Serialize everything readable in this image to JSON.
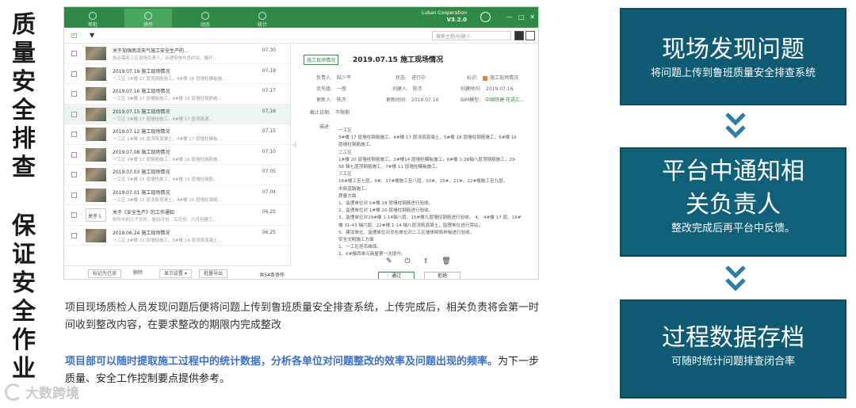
{
  "vertical_title": {
    "part1": [
      "质",
      "量",
      "安",
      "全",
      "排",
      "查"
    ],
    "part2": [
      "保",
      "证",
      "安",
      "全",
      "作",
      "业"
    ]
  },
  "app": {
    "nav": [
      "审批",
      "协作",
      "动态",
      "统计"
    ],
    "brand": "Luban Cooperation",
    "version": "V3.2.0",
    "window_buttons": [
      "—",
      "□",
      "✕"
    ],
    "search_placeholder": "搜索主题/创建人",
    "list": [
      {
        "title": "关于加强南流天气施工安全生产的...",
        "sub": "各必需各工区现场负责人，合理安排作息时间，确开...",
        "date": "07.30",
        "doc": false
      },
      {
        "title": "2019.07.19 施工现场情况",
        "sub": "一工区 3#楼 17 层顶钢筋施工，4#楼 18 层墙柱模板施...",
        "date": "07.19",
        "doc": false
      },
      {
        "title": "2019.07.16 施工现场情况",
        "sub": "一工区 3#楼 17 层楼板施工，4#楼 18 层墙柱钢筋施...",
        "date": "07.17",
        "doc": false
      },
      {
        "title": "2019.07.15 施工现场情况",
        "sub": "一工区 3#楼 17 层墙柱施工，4#楼 17 层浇筑混...",
        "date": "07.16",
        "doc": false
      },
      {
        "title": "2019.07.12 施工现场情况",
        "sub": "一工区 1#楼 16 层浇筑混凝土，4#楼 17 层墙柱模板...",
        "date": "07.15",
        "doc": false
      },
      {
        "title": "2019.07.08 施工现场情况",
        "sub": "一工区 3#楼 17 层钢筋施工，4#楼 16 层墙柱钢筋施...",
        "date": "07.10",
        "doc": false
      },
      {
        "title": "2019.07.03 施工现场情况",
        "sub": "一工区 3#楼 15 层墙柱施工，4#楼 16 层墙柱钢筋...",
        "date": "07.05",
        "doc": false
      },
      {
        "title": "2019.07.01 施工现场情况",
        "sub": "一工区 3#楼 15 层浇筑混凝土，4#楼 15 层墙柱钢筋...",
        "date": "07.04",
        "doc": false
      },
      {
        "title": "关于《安全生产》的工作通知",
        "sub": "附件中的几个文件，是四月份、五月份、六月份建工...",
        "date": "06.25",
        "doc": true,
        "doc_label": "关于ｌ"
      },
      {
        "title": "2019.06.24 施工现场情况",
        "sub": "一工区 3#楼 15 层墙柱施工，5#楼 14 层浇筑混凝土...",
        "date": "06.25",
        "doc": false
      }
    ],
    "list_footer": {
      "mark_read": "标记为已读",
      "delete": "删除",
      "display": "显示设置 ▾",
      "export": "批量导出",
      "count": "共54条协作"
    },
    "detail": {
      "tag": "施工现场情况",
      "title": "2019.07.15 施工现场情况",
      "fields": [
        {
          "k": "负责人:",
          "v": "陆少平"
        },
        {
          "k": "状态:",
          "v": "进行中"
        },
        {
          "k": "标识:",
          "v": "施工现场情况"
        },
        {
          "k": "优先级:",
          "v": "一般"
        },
        {
          "k": "创建人:",
          "v": "陈杰"
        },
        {
          "k": "创建时间:",
          "v": "2019.07.16"
        },
        {
          "k": "更新人:",
          "v": "陈杰"
        },
        {
          "k": "更新时间:",
          "v": "2019.07.16"
        },
        {
          "k": "BIM模型:",
          "v": "中国铁建·花语汇..."
        },
        {
          "k": "截止日期:",
          "v": "不限期"
        }
      ],
      "desc_label": "描述:",
      "desc_lines": [
        "一工区",
        "3#楼 17 层墙柱钢筋施工，4#楼 17 层浇筑混凝土，5#楼 18 层墙柱钢筋施工，6#楼 16",
        "层墙柱钢筋施工。",
        "二工区",
        "1#楼 20 层墙柱钢筋施工，2#楼14 层墙柱模板施工，6#楼 1-28轴八层顶钢筋施工，29-",
        "58 轴七层顶钢筋施工，7#楼 11 层墙柱模板施工。",
        "三工区",
        "16#楼工至七层，9#、17#楼施工至八层，10#、15#、21#、22#楼施工至九层。",
        "市政道路施工。",
        "质量方面:",
        "1、监理单位对 5#楼 18 层墙柱钢筋进行验收。",
        "2、监理单位对 1#楼 20 层墙柱钢筋进行验收。",
        "3、监理单位对29#楼 1-14轴八层、15#楼九层墙柱钢筋进行验收。 4、 4#楼 17 层、16#",
        "楼 31-43 轴六层、22#楼 1-14 轴八层浇筑混凝土，监理单位进行旁站。",
        "5、建设单位、监理单位对总包单位对二工区墙体砌筑样板进行验收。",
        "安全文明施工方面",
        "1、一工区塔吊维保。",
        "2、6#楼西单元商屋第一次提升。"
      ],
      "approve": "通过",
      "reject": "拒绝"
    }
  },
  "body": {
    "para1": "项目现场质检人员发现问题后便将问题上传到鲁班质量安全排查系统，上传完成后，相关负责将会第一时间收到整改内容，在要求整改的期限内完成整改",
    "para2_highlight": "项目部可以随时提取施工过程中的统计数据，分析各单位对问题整改的效率及问题出现的频率。",
    "para2_rest": "为下一步质量、安全工作控制要点提供参考。"
  },
  "watermark": "大数跨境",
  "cards": [
    {
      "title": "现场发现问题",
      "subtitle": "将问题上传到鲁班质量安全排查系统"
    },
    {
      "title_line1": "平台中通知相",
      "title_line2": "关负责人",
      "subtitle": "整改完成后再平台中反馈。"
    },
    {
      "title": "过程数据存档",
      "subtitle": "可随时统计问题排查闭合率"
    }
  ],
  "colors": {
    "app_green": "#2f8a46",
    "card_blue": "#0f5b74",
    "highlight_blue": "#3b6fc4",
    "chevron_blue": "#2b7fa6"
  },
  "icons": [
    "filter-icon",
    "select-all-icon",
    "chat-icon",
    "edit-icon",
    "power-icon",
    "export-icon",
    "trash-icon",
    "chevron-down-icon"
  ]
}
